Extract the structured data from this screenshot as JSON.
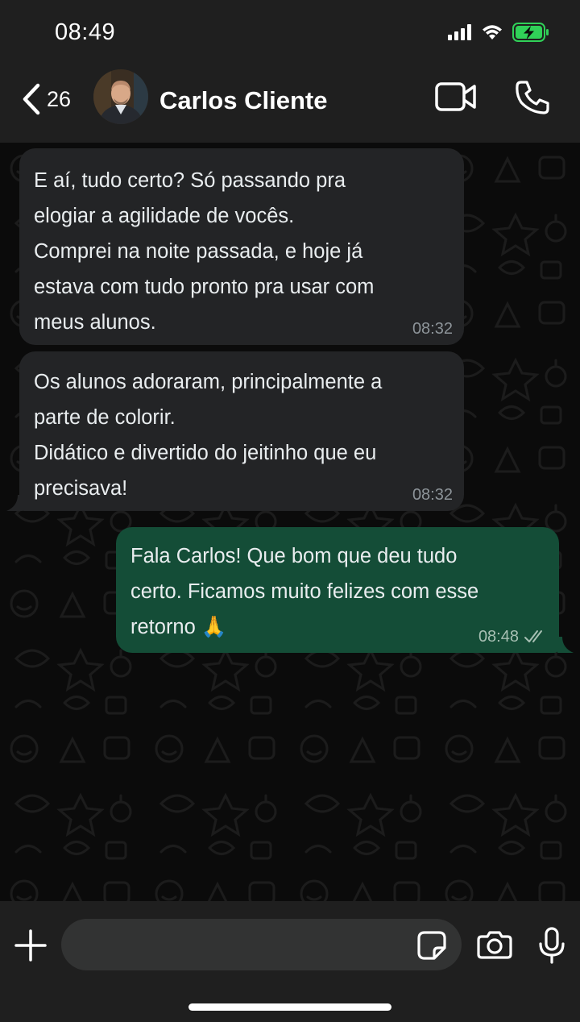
{
  "status_bar": {
    "time": "08:49",
    "icons": [
      "signal-icon",
      "wifi-icon",
      "battery-charging-icon"
    ],
    "battery_color": "#30d158"
  },
  "header": {
    "back_count": "26",
    "contact_name": "Carlos Cliente",
    "icons": [
      "back-chevron-icon",
      "video-call-icon",
      "phone-icon"
    ]
  },
  "messages": [
    {
      "direction": "in",
      "text": "E aí, tudo certo? Só passando pra\nelogiar a agilidade de vocês.\nComprei na noite passada, e hoje já\nestava com tudo pronto pra usar com\nmeus alunos.",
      "time": "08:32"
    },
    {
      "direction": "in",
      "text": "Os alunos adoraram, principalmente a\nparte de colorir.\nDidático e divertido do jeitinho que eu\nprecisava!",
      "time": "08:32"
    },
    {
      "direction": "out",
      "text": "Fala Carlos! Que bom que deu tudo\ncerto. Ficamos muito felizes com esse\nretorno 🙏",
      "time": "08:48",
      "status": "double-check-icon"
    }
  ],
  "composer": {
    "value": "",
    "icons": [
      "plus-icon",
      "sticker-icon",
      "camera-icon",
      "microphone-icon"
    ]
  },
  "colors": {
    "header_bg": "#1f1f1f",
    "incoming_bubble": "#232426",
    "outgoing_bubble": "#144d37",
    "chat_bg": "#0b0b0b"
  }
}
